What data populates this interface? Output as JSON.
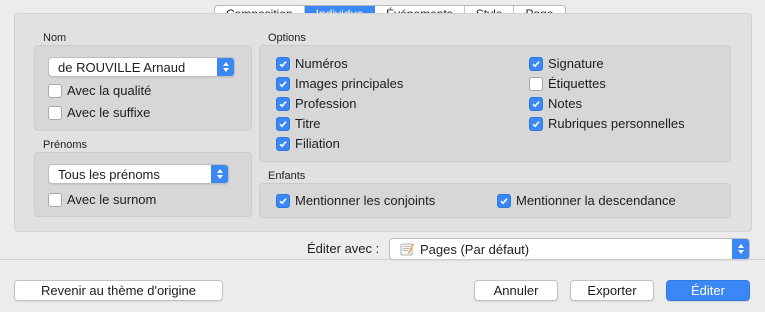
{
  "tabs": [
    "Composition",
    "Individus",
    "Événements",
    "Style",
    "Page"
  ],
  "active_tab": "Individus",
  "nom": {
    "title": "Nom",
    "popup_value": "de ROUVILLE Arnaud",
    "cb_qualite": {
      "label": "Avec la qualité",
      "checked": false
    },
    "cb_suffixe": {
      "label": "Avec le suffixe",
      "checked": false
    }
  },
  "prenoms": {
    "title": "Prénoms",
    "popup_value": "Tous les prénoms",
    "cb_surnom": {
      "label": "Avec le surnom",
      "checked": false
    }
  },
  "options": {
    "title": "Options",
    "left": [
      {
        "label": "Numéros",
        "checked": true
      },
      {
        "label": "Images principales",
        "checked": true
      },
      {
        "label": "Profession",
        "checked": true
      },
      {
        "label": "Titre",
        "checked": true
      },
      {
        "label": "Filiation",
        "checked": true
      }
    ],
    "right": [
      {
        "label": "Signature",
        "checked": true
      },
      {
        "label": "Étiquettes",
        "checked": false
      },
      {
        "label": "Notes",
        "checked": true
      },
      {
        "label": "Rubriques personnelles",
        "checked": true
      }
    ]
  },
  "enfants": {
    "title": "Enfants",
    "cb_conjoints": {
      "label": "Mentionner les conjoints",
      "checked": true
    },
    "cb_descendance": {
      "label": "Mentionner la descendance",
      "checked": true
    }
  },
  "editer_avec": {
    "label": "Éditer avec :",
    "value": "Pages (Par défaut)"
  },
  "buttons": {
    "revert": "Revenir au thème d'origine",
    "cancel": "Annuler",
    "export": "Exporter",
    "edit": "Éditer"
  },
  "colors": {
    "accent": "#3a87f5"
  }
}
